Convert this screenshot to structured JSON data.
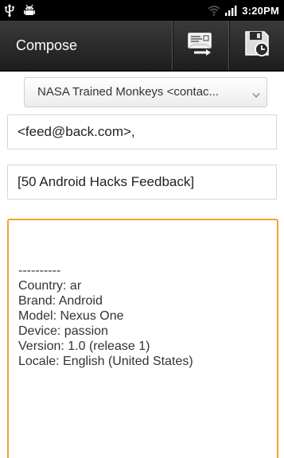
{
  "status_bar": {
    "time": "3:20PM",
    "icons": [
      "usb-icon",
      "android-debug-icon",
      "wifi-icon",
      "signal-icon"
    ]
  },
  "action_bar": {
    "title": "Compose",
    "send_icon": "send-icon",
    "save_icon": "save-draft-icon"
  },
  "compose": {
    "from": "NASA Trained Monkeys <contac...",
    "to": "<feed@back.com>,",
    "subject": "[50 Android Hacks Feedback]",
    "body_lines": [
      "----------",
      "Country: ar",
      "Brand: Android",
      "Model: Nexus One",
      "Device: passion",
      "Version: 1.0 (release 1)",
      "Locale: English (United States)"
    ]
  },
  "colors": {
    "status_bar_bg": "#000000",
    "action_bar_bg": "#2a2a2a",
    "focus_border": "#f0a030"
  }
}
